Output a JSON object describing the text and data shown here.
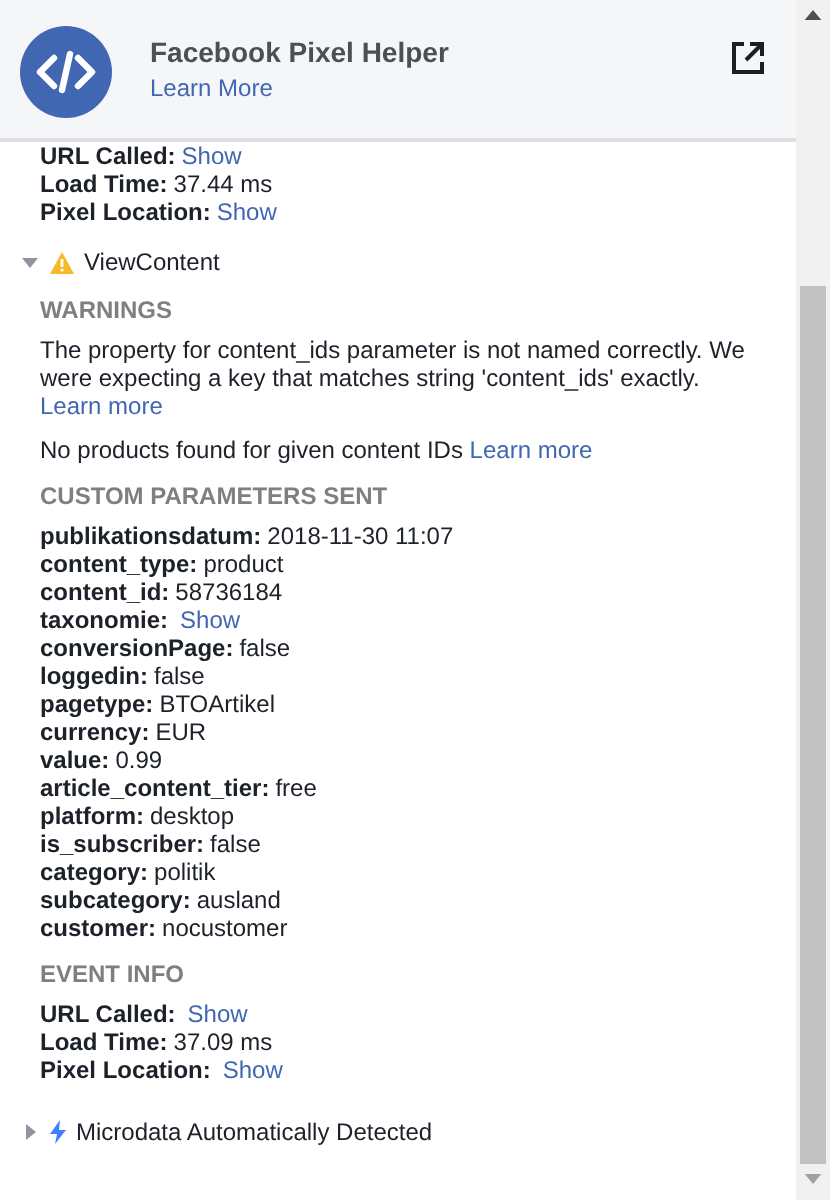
{
  "header": {
    "title": "Facebook Pixel Helper",
    "link": "Learn More"
  },
  "pixel_info": [
    {
      "label": "URL Called:",
      "value": "Show",
      "kind": "link"
    },
    {
      "label": "Load Time:",
      "value": "37.44 ms",
      "kind": "text"
    },
    {
      "label": "Pixel Location:",
      "value": "Show",
      "kind": "link"
    }
  ],
  "events": [
    {
      "name": "ViewContent",
      "kind": "warning",
      "expanded": true,
      "warnings_heading": "WARNINGS",
      "warnings": [
        {
          "text": "The property for content_ids parameter is not named correctly. We were expecting a key that matches string 'content_ids' exactly.",
          "link": "Learn more"
        },
        {
          "text": "No products found for given content IDs",
          "link": "Learn more"
        }
      ],
      "params_heading": "CUSTOM PARAMETERS SENT",
      "params": [
        {
          "label": "publikationsdatum:",
          "value": "2018-11-30 11:07",
          "kind": "text"
        },
        {
          "label": "content_type:",
          "value": "product",
          "kind": "text"
        },
        {
          "label": "content_id:",
          "value": "58736184",
          "kind": "text"
        },
        {
          "label": "taxonomie:",
          "value": "Show",
          "kind": "link"
        },
        {
          "label": "conversionPage:",
          "value": "false",
          "kind": "text"
        },
        {
          "label": "loggedin:",
          "value": "false",
          "kind": "text"
        },
        {
          "label": "pagetype:",
          "value": "BTOArtikel",
          "kind": "text"
        },
        {
          "label": "currency:",
          "value": "EUR",
          "kind": "text"
        },
        {
          "label": "value:",
          "value": "0.99",
          "kind": "text"
        },
        {
          "label": "article_content_tier:",
          "value": "free",
          "kind": "text"
        },
        {
          "label": "platform:",
          "value": "desktop",
          "kind": "text"
        },
        {
          "label": "is_subscriber:",
          "value": "false",
          "kind": "text"
        },
        {
          "label": "category:",
          "value": "politik",
          "kind": "text"
        },
        {
          "label": "subcategory:",
          "value": "ausland",
          "kind": "text"
        },
        {
          "label": "customer:",
          "value": "nocustomer",
          "kind": "text"
        }
      ],
      "info_heading": "EVENT INFO",
      "info": [
        {
          "label": "URL Called:",
          "value": "Show",
          "kind": "link"
        },
        {
          "label": "Load Time:",
          "value": "37.09 ms",
          "kind": "text"
        },
        {
          "label": "Pixel Location:",
          "value": "Show",
          "kind": "link"
        }
      ]
    },
    {
      "name": "Microdata Automatically Detected",
      "kind": "bolt",
      "expanded": false
    }
  ]
}
